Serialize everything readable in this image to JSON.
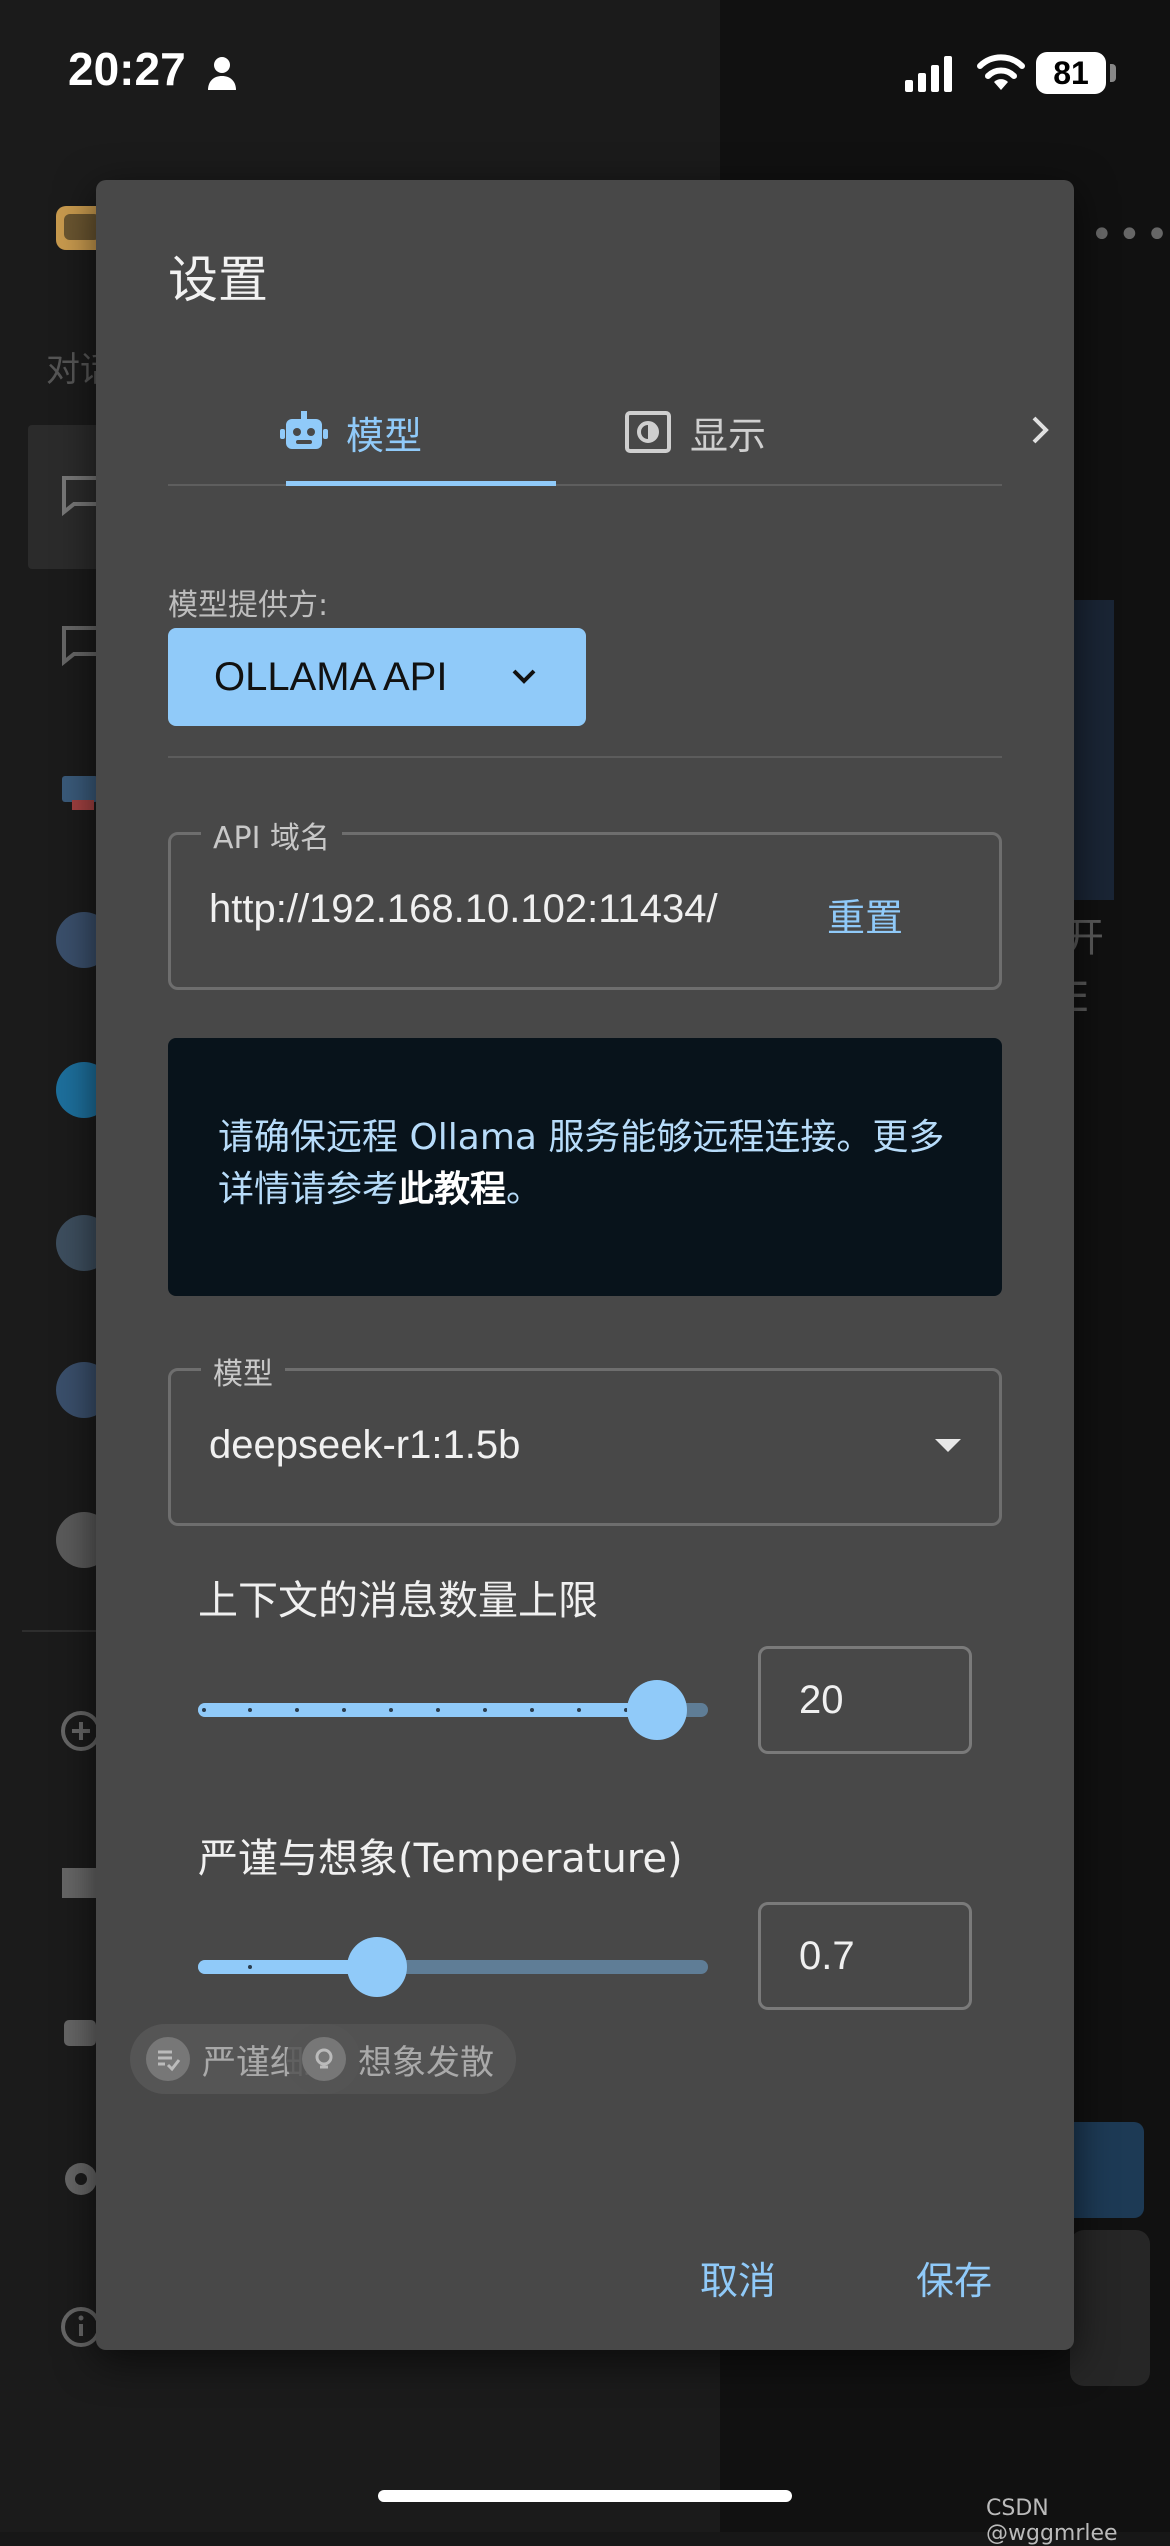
{
  "status_bar": {
    "time": "20:27",
    "battery": "81"
  },
  "dialog": {
    "title": "设置",
    "tabs": [
      {
        "label": "模型",
        "icon": "robot-icon",
        "active": true
      },
      {
        "label": "显示",
        "icon": "display-icon",
        "active": false
      }
    ],
    "provider": {
      "label": "模型提供方:",
      "value": "OLLAMA API"
    },
    "api_host": {
      "legend": "API 域名",
      "value": "http://192.168.10.102:11434/",
      "reset_label": "重置"
    },
    "info": {
      "text": "请确保远程 Ollama 服务能够远程连接。更多详情请参考",
      "link": "此教程",
      "suffix": "。"
    },
    "model": {
      "legend": "模型",
      "value": "deepseek-r1:1.5b"
    },
    "context_limit": {
      "label": "上下文的消息数量上限",
      "value": "20",
      "fraction": 0.9
    },
    "temperature": {
      "label": "严谨与想象(Temperature)",
      "value": "0.7",
      "fraction": 0.35
    },
    "chips": {
      "strict": "严谨细致",
      "creative": "想象发散"
    },
    "cancel_label": "取消",
    "save_label": "保存"
  },
  "background": {
    "sidebar_label": "对话",
    "right_text_1": "开",
    "right_text_2": "E"
  },
  "watermark": "CSDN @wggmrlee",
  "colors": {
    "accent": "#90caf9",
    "dialog_bg": "#484848",
    "info_bg": "#08131b"
  }
}
